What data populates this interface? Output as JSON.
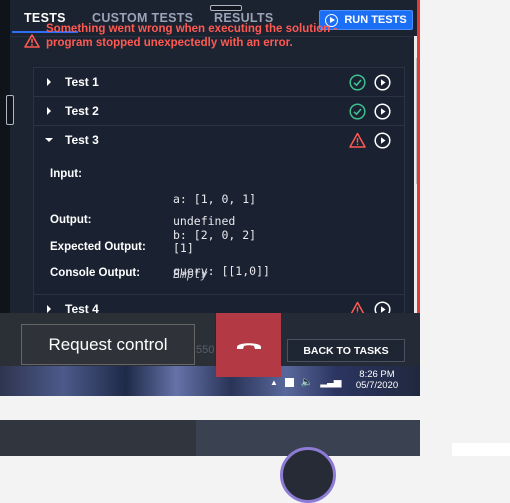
{
  "tabs": [
    {
      "label": "TESTS",
      "active": true
    },
    {
      "label": "CUSTOM TESTS",
      "active": false
    },
    {
      "label": "RESULTS",
      "active": false
    }
  ],
  "run_button": {
    "label": "RUN TESTS",
    "icon": "play-circle-icon"
  },
  "error": {
    "line1": "Something went wrong when executing the solution -",
    "line2": "program stopped unexpectedly with an error.",
    "icon": "warning-triangle-icon",
    "color": "#ff5a52"
  },
  "tests": [
    {
      "name": "Test 1",
      "status": "passed",
      "expanded": false
    },
    {
      "name": "Test 2",
      "status": "passed",
      "expanded": false
    },
    {
      "name": "Test 3",
      "status": "error",
      "expanded": true
    },
    {
      "name": "Test 4",
      "status": "error",
      "expanded": false
    }
  ],
  "test3_details": {
    "input_label": "Input:",
    "input_lines": [
      "a: [1, 0, 1]",
      "b: [2, 0, 2]",
      "query: [[1,0]]"
    ],
    "output_label": "Output:",
    "output_value": "undefined",
    "expected_label": "Expected Output:",
    "expected_value": "[1]",
    "console_label": "Console Output:",
    "console_value": "Empty"
  },
  "bottom": {
    "request_control": "Request control",
    "back_to_tasks": "BACK TO TASKS",
    "faint_text": "550"
  },
  "taskbar": {
    "time": "8:26 PM",
    "date": "05/7/2020"
  },
  "colors": {
    "accent": "#1b6ff5",
    "pass": "#3fbf8f",
    "fail": "#ff5a52",
    "hangup": "#b33a44"
  }
}
